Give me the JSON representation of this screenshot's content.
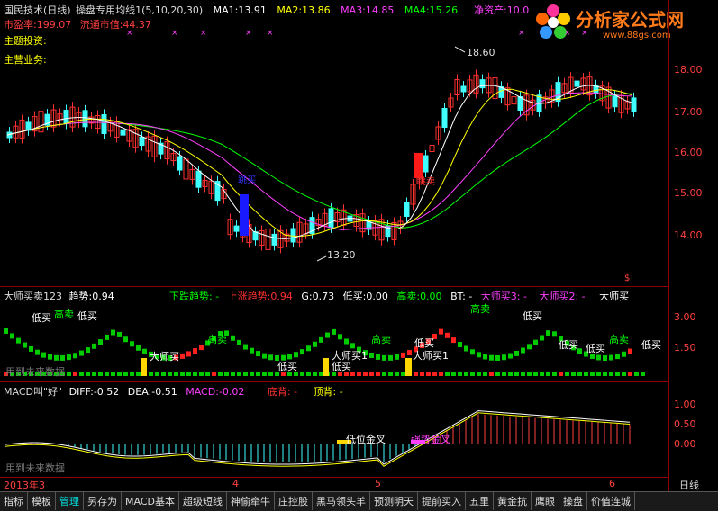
{
  "header": {
    "title": "国民技术(日线)",
    "indicator": "操盘专用均线1(5,10,20,30)",
    "ma1_label": "MA1:",
    "ma1": "13.91",
    "ma2_label": "MA2:",
    "ma2": "13.86",
    "ma3_label": "MA3:",
    "ma3": "14.85",
    "ma4_label": "MA4:",
    "ma4": "15.26",
    "net_asset_label": "净资产:",
    "net_asset": "10.0",
    "pe_label": "市盈率:",
    "pe": "199.07",
    "float_label": "流通市值:",
    "float": "44.37",
    "theme_label": "主题投资:",
    "business_label": "主营业务:"
  },
  "logo": {
    "name": "分析家公式网",
    "url": "www.88gs.com"
  },
  "main_chart": {
    "high_label": "18.60",
    "low_label": "13.20",
    "sell_tag": "跳卖",
    "buy_tag": "跳买",
    "yaxis": [
      "18.00",
      "17.00",
      "16.00",
      "15.00",
      "14.00"
    ],
    "colors": {
      "ma1": "#ffffff",
      "ma2": "#ffff00",
      "ma3": "#ff40ff",
      "ma4": "#00ff00",
      "up": "#ff3030",
      "down": "#40ffff"
    }
  },
  "panel2": {
    "name": "大师买卖123",
    "trend_label": "趋势:",
    "trend": "0.94",
    "down_label": "下跌趋势: -",
    "up_label": "上涨趋势:",
    "up": "0.94",
    "g_label": "G:",
    "g": "0.73",
    "lowbuy_label": "低买:",
    "lowbuy": "0.00",
    "highsell_label": "高卖:",
    "highsell": "0.00",
    "bt_label": "BT: -",
    "m3_label": "大师买3: -",
    "m2_label": "大师买2: -",
    "m1_label": "大师买",
    "watermark": "用到未来数据",
    "yaxis": [
      "3.00",
      "1.50"
    ],
    "tags": {
      "low_buy": "低买",
      "high_sell": "高卖",
      "master_sell": "大师买",
      "master_buy1": "大师买1",
      "master_buy1b": "大师买1",
      "master_buy_low": "低买"
    }
  },
  "panel3": {
    "name": "MACD叫\"好\"",
    "diff_label": "DIFF:",
    "diff": "-0.52",
    "dea_label": "DEA:",
    "dea": "-0.51",
    "macd_label": "MACD:",
    "macd": "-0.02",
    "bottom_div": "底背: -",
    "top_div": "顶背: -",
    "watermark": "用到未来数据",
    "golden_cross": "低位金叉",
    "golden_cross2": "强势金叉",
    "yaxis": [
      "1.00",
      "0.50",
      "0.00"
    ]
  },
  "xaxis": {
    "year": "2013年3",
    "m4": "4",
    "m5": "5",
    "m6": "6",
    "period": "日线"
  },
  "tabs": [
    "指标",
    "模板",
    "管理",
    "另存为",
    "MACD基本",
    "超级短线",
    "神偷牵牛",
    "庄控股",
    "黑马领头羊",
    "预测明天",
    "提前买入",
    "五里",
    "黄金抗",
    "鹰眼",
    "操盘",
    "价值连城"
  ]
}
